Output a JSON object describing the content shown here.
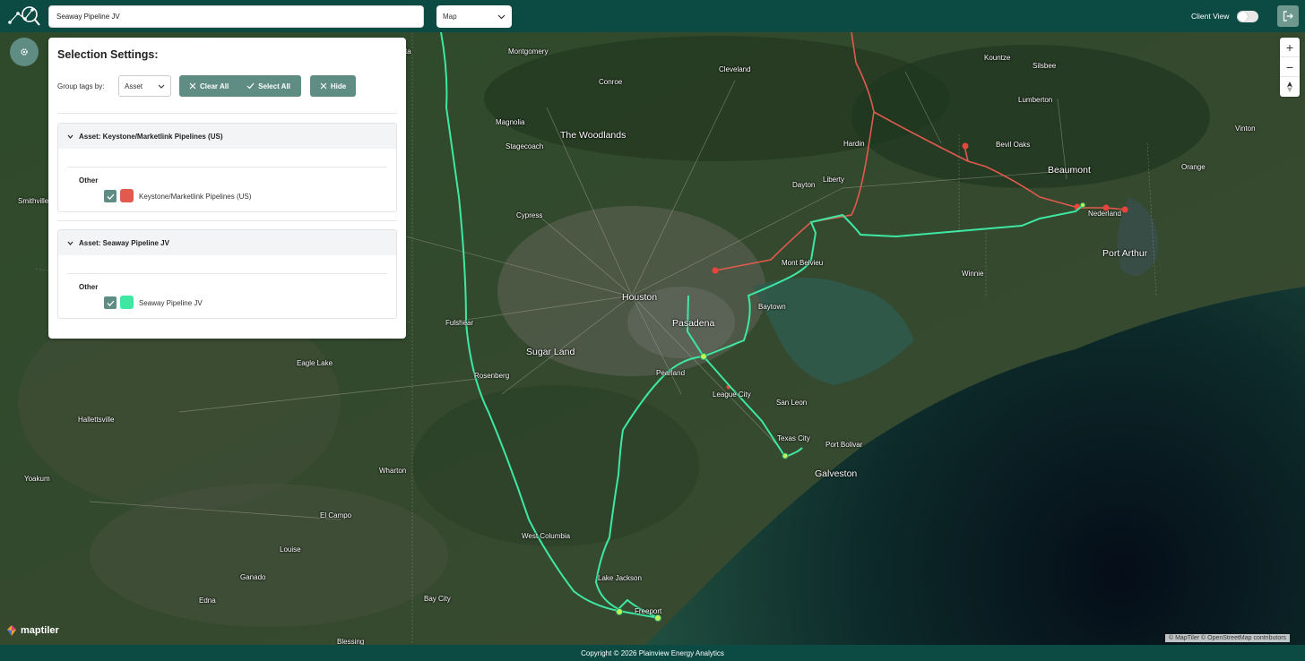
{
  "header": {
    "search_value": "Seaway Pipeline JV",
    "view_select": "Map",
    "client_view_label": "Client View",
    "client_view_on": false
  },
  "panel": {
    "title": "Selection Settings:",
    "group_label": "Group tags by:",
    "group_value": "Asset",
    "clear_all": "Clear All",
    "select_all": "Select All",
    "hide": "Hide",
    "assets": [
      {
        "header": "Asset: Keystone/Marketlink Pipelines (US)",
        "category": "Other",
        "item": "Keystone/Marketlink Pipelines (US)",
        "color": "#e05a4e",
        "checked": true
      },
      {
        "header": "Asset: Seaway Pipeline JV",
        "category": "Other",
        "item": "Seaway Pipeline JV",
        "color": "#3ee8a3",
        "checked": true
      }
    ]
  },
  "map": {
    "cities": [
      {
        "name": "Montgomery"
      },
      {
        "name": "Cleveland"
      },
      {
        "name": "Kountze"
      },
      {
        "name": "Silsbee"
      },
      {
        "name": "Conroe"
      },
      {
        "name": "Lumberton"
      },
      {
        "name": "Magnolia"
      },
      {
        "name": "Vinton"
      },
      {
        "name": "The Woodlands"
      },
      {
        "name": "Stagecoach"
      },
      {
        "name": "Hardin"
      },
      {
        "name": "Bevil Oaks"
      },
      {
        "name": "Beaumont"
      },
      {
        "name": "Orange"
      },
      {
        "name": "Dayton"
      },
      {
        "name": "Liberty"
      },
      {
        "name": "Smithville"
      },
      {
        "name": "Cypress"
      },
      {
        "name": "Nederland"
      },
      {
        "name": "Port Arthur"
      },
      {
        "name": "Mont Belvieu"
      },
      {
        "name": "Winnie"
      },
      {
        "name": "Houston"
      },
      {
        "name": "Baytown"
      },
      {
        "name": "Pasadena"
      },
      {
        "name": "Fulshear"
      },
      {
        "name": "Sugar Land"
      },
      {
        "name": "Eagle Lake"
      },
      {
        "name": "Pearland"
      },
      {
        "name": "Rosenberg"
      },
      {
        "name": "League City"
      },
      {
        "name": "Hallettsville"
      },
      {
        "name": "San Leon"
      },
      {
        "name": "Texas City"
      },
      {
        "name": "Port Bolivar"
      },
      {
        "name": "Wharton"
      },
      {
        "name": "Galveston"
      },
      {
        "name": "Yoakum"
      },
      {
        "name": "El Campo"
      },
      {
        "name": "West Columbia"
      },
      {
        "name": "Louise"
      },
      {
        "name": "Lake Jackson"
      },
      {
        "name": "Ganado"
      },
      {
        "name": "Bay City"
      },
      {
        "name": "Freeport"
      },
      {
        "name": "Edna"
      },
      {
        "name": "Blessing"
      },
      {
        "name": "ta"
      }
    ],
    "brand": "maptiler",
    "attribution": "© MapTiler © OpenStreetMap contributors",
    "zoom_in": "+",
    "zoom_out": "−"
  },
  "footer": {
    "copyright": "Copyright © 2026 Plainview Energy Analytics"
  },
  "colors": {
    "bar": "#0c4b43",
    "accent": "#5f8c83",
    "keystone": "#e05a4e",
    "seaway": "#3ee8a3"
  }
}
